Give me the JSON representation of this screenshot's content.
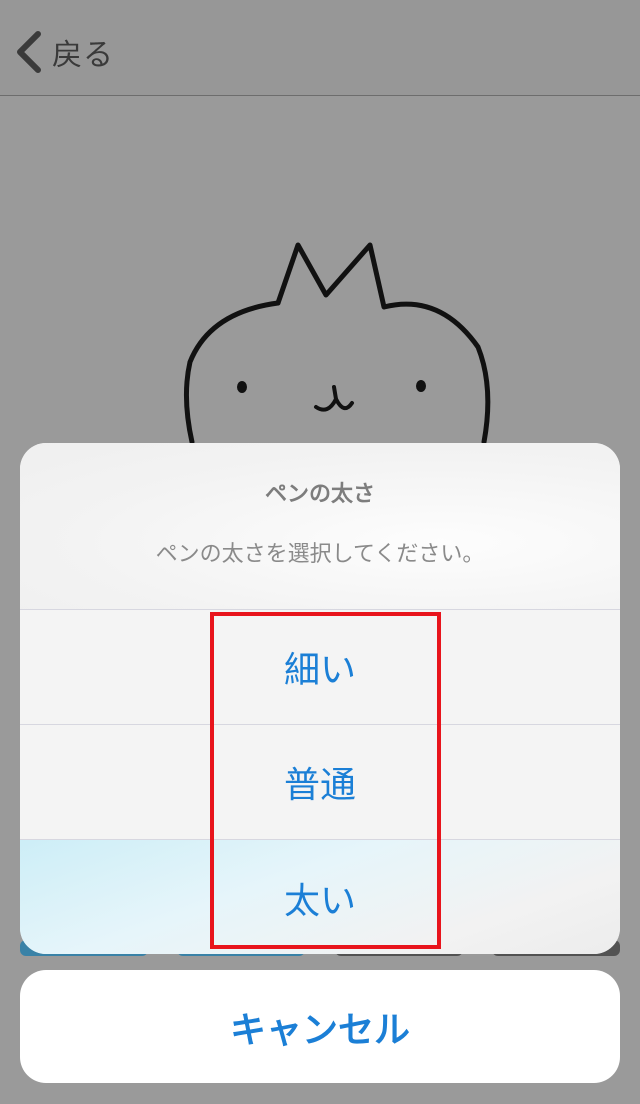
{
  "navbar": {
    "back_label": "戻る",
    "back_icon": "chevron-left-icon"
  },
  "action_sheet": {
    "title": "ペンの太さ",
    "message": "ペンの太さを選択してください。",
    "options": [
      {
        "label": "細い"
      },
      {
        "label": "普通"
      },
      {
        "label": "太い"
      }
    ],
    "cancel_label": "キャンセル"
  },
  "colors": {
    "overlay_background": "#9a9a9a",
    "sheet_background": "#f4f4f4",
    "action_text": "#1b7fd6",
    "highlight_border": "#e8141c"
  }
}
